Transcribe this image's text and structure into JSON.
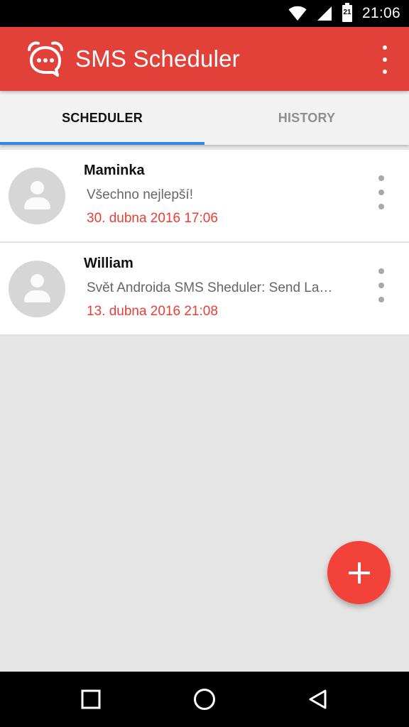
{
  "status_bar": {
    "time": "21:06",
    "battery_level": "21",
    "icons": [
      "wifi-icon",
      "signal-icon",
      "battery-icon"
    ]
  },
  "app_bar": {
    "title": "SMS Scheduler",
    "logo_icon": "alarm-chat-icon",
    "menu_icon": "more-vert-icon"
  },
  "tabs": [
    {
      "label": "SCHEDULER",
      "active": true
    },
    {
      "label": "HISTORY",
      "active": false
    }
  ],
  "scheduled": [
    {
      "name": "Maminka",
      "message": "Všechno nejlepší!",
      "date": "30. dubna 2016 17:06"
    },
    {
      "name": "William",
      "message": "Svět Androida SMS Sheduler: Send La…",
      "date": "13. dubna 2016 21:08"
    }
  ],
  "fab": {
    "icon": "plus-icon"
  },
  "nav_bar": {
    "icons": [
      "recents-icon",
      "home-icon",
      "back-icon"
    ]
  },
  "colors": {
    "primary": "#e2413a",
    "accent": "#f2423a",
    "tab_indicator": "#2f8ae0",
    "date_text": "#ea3d35",
    "background": "#e5e5e5"
  }
}
